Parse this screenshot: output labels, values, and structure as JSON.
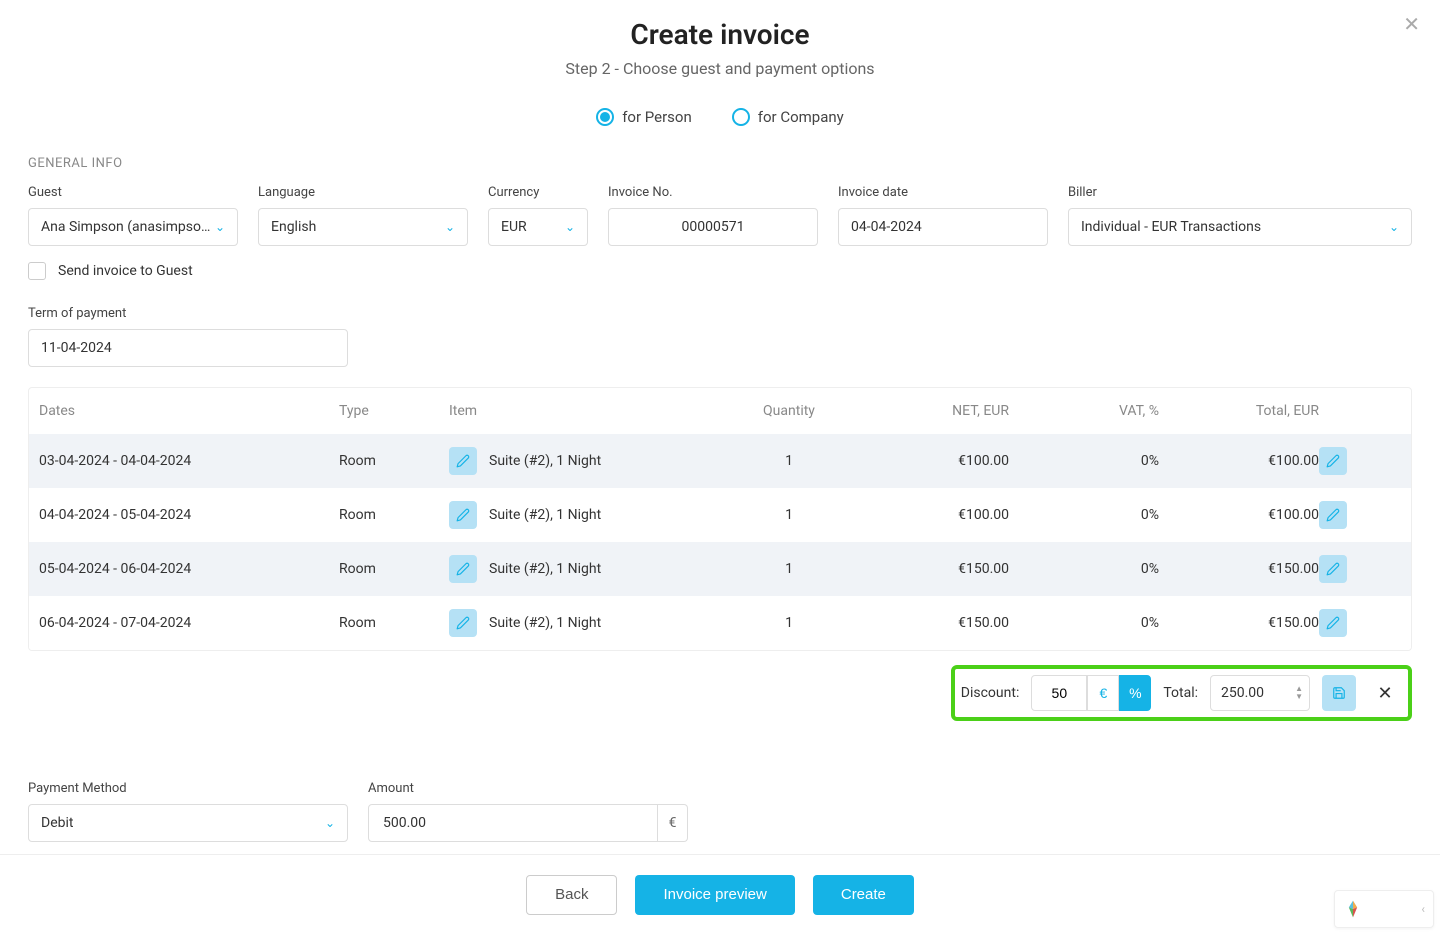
{
  "header": {
    "title": "Create invoice",
    "subtitle": "Step 2 - Choose guest and payment options"
  },
  "invoiceType": {
    "person": "for Person",
    "company": "for Company"
  },
  "sections": {
    "generalInfo": "GENERAL INFO"
  },
  "labels": {
    "guest": "Guest",
    "language": "Language",
    "currency": "Currency",
    "invoiceNo": "Invoice No.",
    "invoiceDate": "Invoice date",
    "biller": "Biller",
    "sendToGuest": "Send invoice to Guest",
    "termOfPayment": "Term of payment",
    "paymentMethod": "Payment Method",
    "amount": "Amount",
    "discount": "Discount:",
    "total": "Total:"
  },
  "values": {
    "guest": "Ana Simpson (anasimpso…",
    "language": "English",
    "currency": "EUR",
    "invoiceNo": "00000571",
    "invoiceDate": "04-04-2024",
    "biller": "Individual - EUR Transactions",
    "termOfPayment": "11-04-2024",
    "discountValue": "50",
    "euroSymbol": "€",
    "percentSymbol": "%",
    "totalValue": "250.00",
    "paymentMethod": "Debit",
    "amount": "500.00",
    "amountUnit": "€"
  },
  "table": {
    "headers": {
      "dates": "Dates",
      "type": "Type",
      "item": "Item",
      "quantity": "Quantity",
      "net": "NET, EUR",
      "vat": "VAT, %",
      "total": "Total, EUR"
    },
    "rows": [
      {
        "dates": "03-04-2024 - 04-04-2024",
        "type": "Room",
        "item": "Suite  (#2), 1 Night",
        "quantity": "1",
        "net": "€100.00",
        "vat": "0%",
        "total": "€100.00"
      },
      {
        "dates": "04-04-2024 - 05-04-2024",
        "type": "Room",
        "item": "Suite  (#2), 1 Night",
        "quantity": "1",
        "net": "€100.00",
        "vat": "0%",
        "total": "€100.00"
      },
      {
        "dates": "05-04-2024 - 06-04-2024",
        "type": "Room",
        "item": "Suite  (#2), 1 Night",
        "quantity": "1",
        "net": "€150.00",
        "vat": "0%",
        "total": "€150.00"
      },
      {
        "dates": "06-04-2024 - 07-04-2024",
        "type": "Room",
        "item": "Suite  (#2), 1 Night",
        "quantity": "1",
        "net": "€150.00",
        "vat": "0%",
        "total": "€150.00"
      }
    ]
  },
  "footer": {
    "back": "Back",
    "preview": "Invoice preview",
    "create": "Create"
  }
}
